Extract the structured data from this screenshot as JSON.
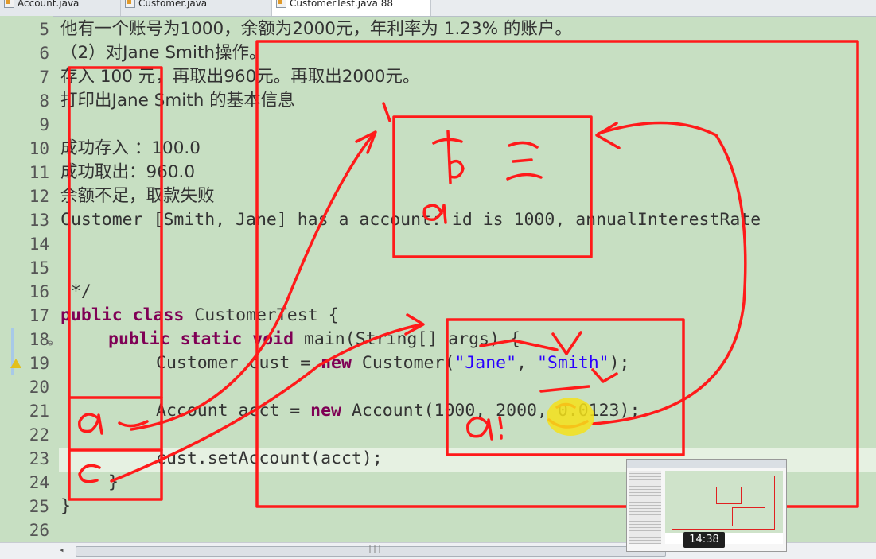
{
  "tabs": [
    {
      "label": "Account.java"
    },
    {
      "label": "Customer.java"
    },
    {
      "label": "CustomerTest.java 88"
    }
  ],
  "line_numbers": [
    "5",
    "6",
    "7",
    "8",
    "9",
    "10",
    "11",
    "12",
    "13",
    "14",
    "15",
    "16",
    "17",
    "18",
    "19",
    "20",
    "21",
    "22",
    "23",
    "24",
    "25",
    "26"
  ],
  "code_lines": {
    "l5": "他有一个账号为1000，余额为2000元，年利率为 1.23% 的账户。",
    "l6": "（2）对Jane Smith操作。",
    "l7": "存入 100 元，再取出960元。再取出2000元。",
    "l8": "打印出Jane Smith 的基本信息",
    "l10": "成功存入 ：100.0",
    "l11": "成功取出：960.0",
    "l12": "余额不足，取款失败",
    "l13": "Customer [Smith, Jane] has a account: id is 1000, annualInterestRate",
    "l16": " */",
    "l17_kw1": "public",
    "l17_kw2": "class",
    "l17_rest": " CustomerTest {",
    "l18_kw1": "public",
    "l18_kw2": "static",
    "l18_kw3": "void",
    "l18_rest": " main(String[] args) {",
    "l19_a": "Customer cust = ",
    "l19_kw": "new",
    "l19_b": " Customer(",
    "l19_s1": "\"Jane\"",
    "l19_c": ", ",
    "l19_s2": "\"Smith\"",
    "l19_d": ");",
    "l21_a": "Account acct = ",
    "l21_kw": "new",
    "l21_b": " Account(1000, 2000, 0.0123);",
    "l23": "cust.setAccount(acct);",
    "l24": "}",
    "l25": "}"
  },
  "video": {
    "timestamp": "14:38"
  },
  "colors": {
    "editor_background": "#c7dfc2",
    "keyword": "#7f0055",
    "string": "#2a00ff",
    "annotation_ink": "#ff1a1a"
  }
}
